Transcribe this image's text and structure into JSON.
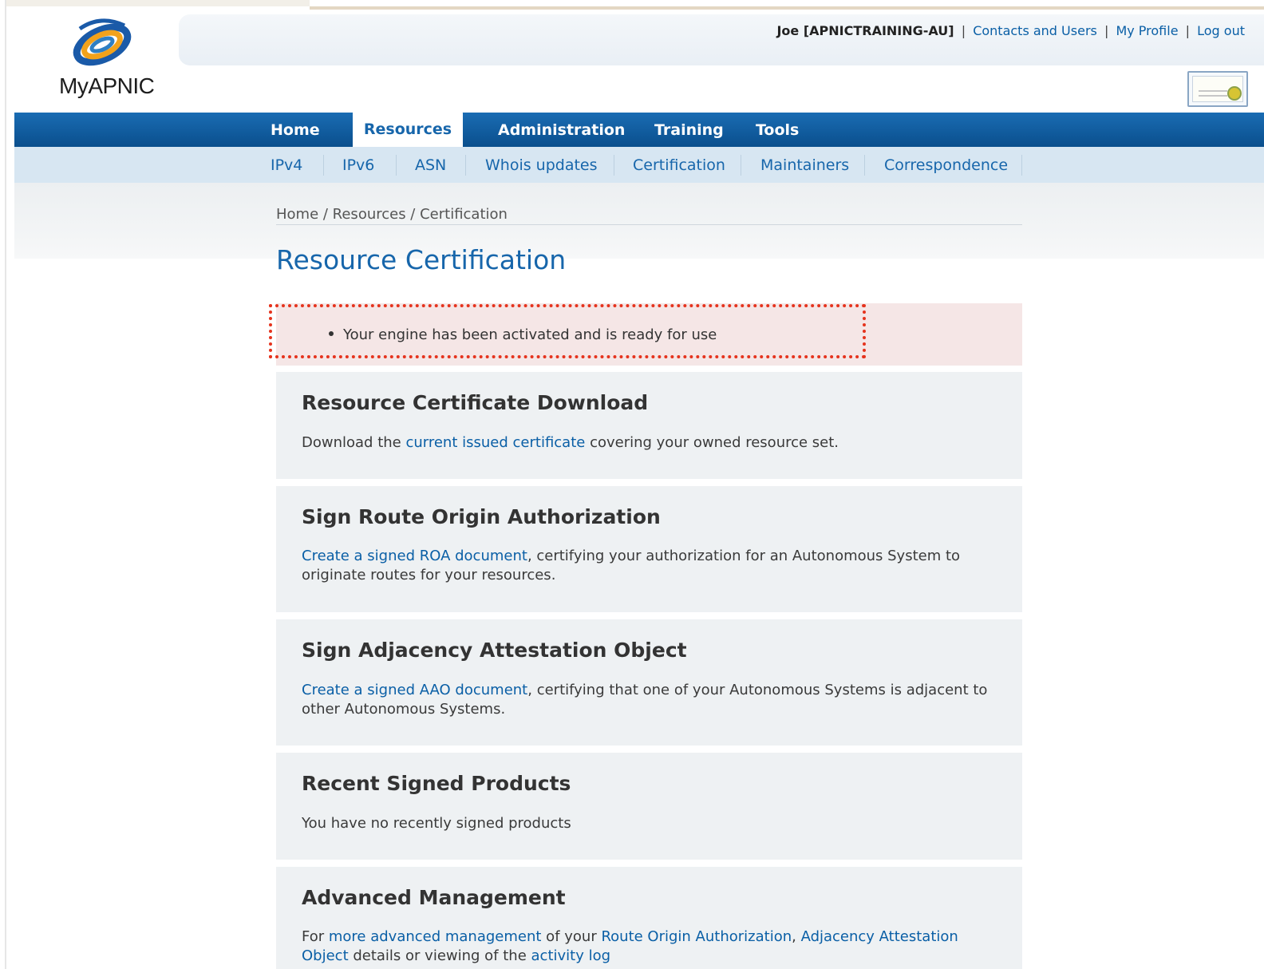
{
  "brand": {
    "logo_text": "MyAPNIC"
  },
  "user_bar": {
    "user": "Joe [APNICTRAINING-AU]",
    "sep": "|",
    "contacts": "Contacts and Users",
    "profile": "My Profile",
    "logout": "Log out"
  },
  "main_nav": [
    "Home",
    "Resources",
    "Administration",
    "Training",
    "Tools"
  ],
  "sub_nav": [
    "IPv4",
    "IPv6",
    "ASN",
    "Whois updates",
    "Certification",
    "Maintainers",
    "Correspondence"
  ],
  "breadcrumb": "Home / Resources / Certification",
  "page_title": "Resource Certification",
  "alert": {
    "message": "Your engine has been activated and is ready for use"
  },
  "panels": {
    "download": {
      "title": "Resource Certificate Download",
      "pre": "Download the ",
      "link": "current issued certificate",
      "post": " covering your owned resource set."
    },
    "roa": {
      "title": "Sign Route Origin Authorization",
      "link": "Create a signed ROA document",
      "post": ", certifying your authorization for an Autonomous System to originate routes for your resources."
    },
    "aao": {
      "title": "Sign Adjacency Attestation Object",
      "link": "Create a signed AAO document",
      "post": ", certifying that one of your Autonomous Systems is adjacent to other Autonomous Systems."
    },
    "recent": {
      "title": "Recent Signed Products",
      "text": "You have no recently signed products"
    },
    "advanced": {
      "title": "Advanced Management",
      "pre": "For ",
      "link1": "more advanced management",
      "mid1": " of your ",
      "link2": "Route Origin Authorization",
      "mid2": ", ",
      "link3": "Adjacency Attestation Object",
      "mid3": " details or viewing of the ",
      "link4": "activity log"
    }
  },
  "colors": {
    "nav_blue": "#0a4f8d",
    "link_blue": "#0a5fa6",
    "subnav_bg": "#d7e6f2",
    "alert_bg": "#f5e6e6",
    "outline_red": "#e5331d"
  }
}
